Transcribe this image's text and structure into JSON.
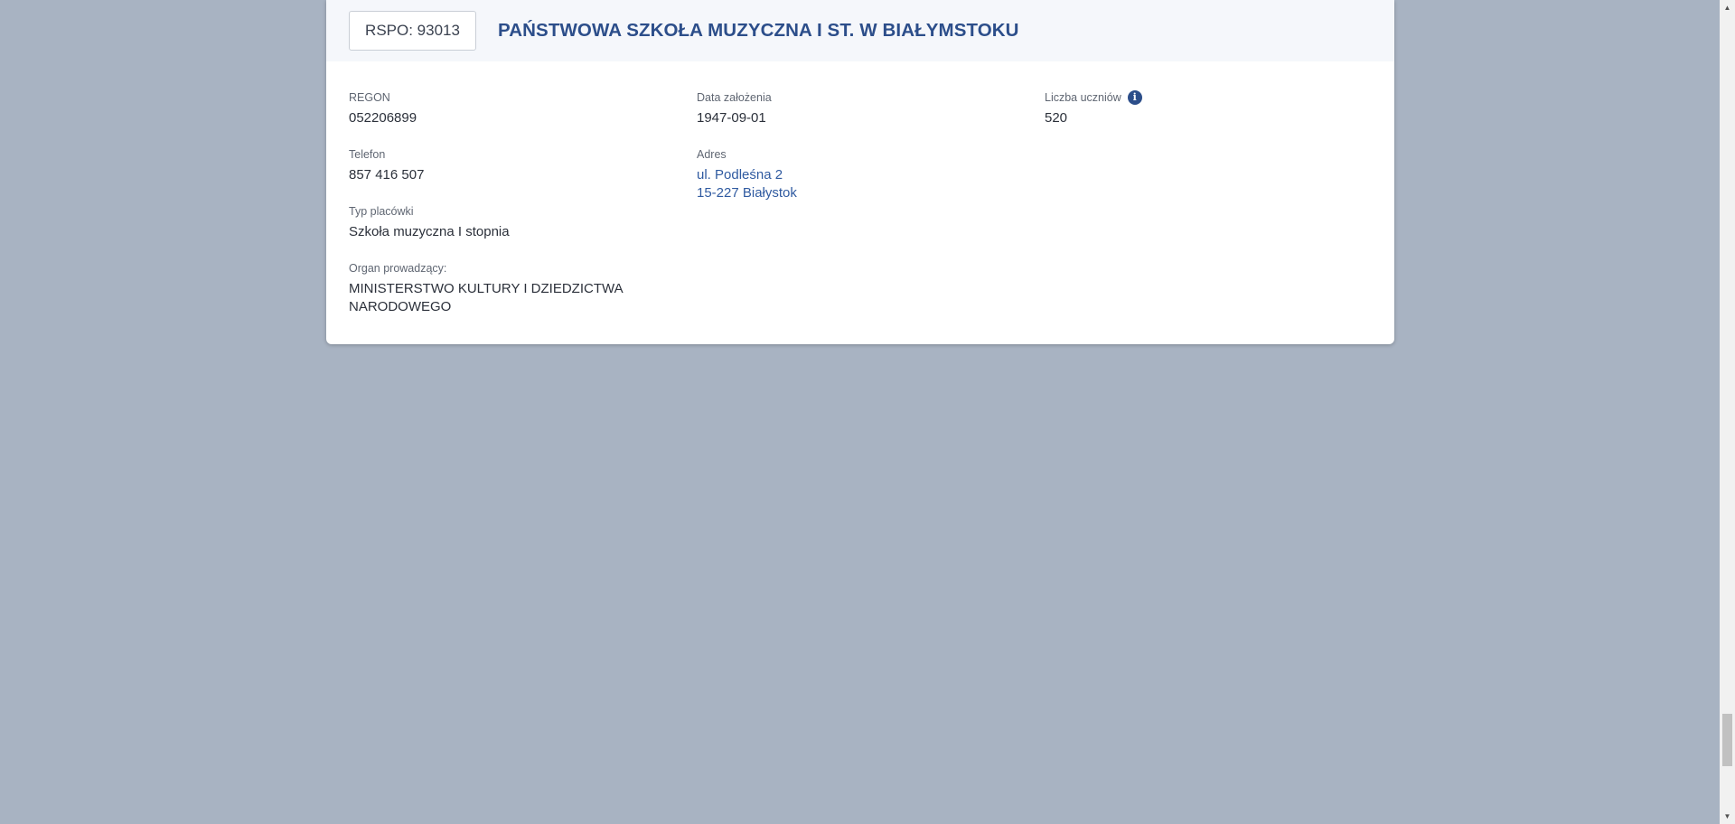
{
  "school": {
    "rspo_label": "RSPO: 93013",
    "name": "PAŃSTWOWA SZKOŁA MUZYCZNA I ST. W BIAŁYMSTOKU"
  },
  "fields": {
    "regon": {
      "label": "REGON",
      "value": "052206899"
    },
    "date": {
      "label": "Data założenia",
      "value": "1947-09-01"
    },
    "students": {
      "label": "Liczba uczniów",
      "value": "520",
      "info_icon": "info-icon"
    },
    "phone": {
      "label": "Telefon",
      "value": "857 416 507"
    },
    "address": {
      "label": "Adres",
      "line1": "ul. Podleśna 2",
      "line2": "15-227 Białystok"
    },
    "type": {
      "label": "Typ placówki",
      "value": "Szkoła muzyczna I stopnia"
    },
    "organ": {
      "label": "Organ prowadzący:",
      "line1": "MINISTERSTWO KULTURY I DZIEDZICTWA",
      "line2": "NARODOWEGO"
    }
  },
  "colors": {
    "background": "#a8b3c2",
    "accent": "#2c4e8a",
    "header_bg": "#f5f7fb"
  },
  "icons": {
    "scroll_up": "scroll-up-arrow-icon",
    "scroll_down": "scroll-down-arrow-icon"
  }
}
